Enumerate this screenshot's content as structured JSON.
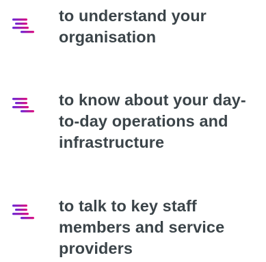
{
  "items": [
    {
      "text": "to understand your organisation",
      "icon": "lines-icon"
    },
    {
      "text": "to know about your day-to-day operations and infrastructure",
      "icon": "lines-icon"
    },
    {
      "text": "to talk to key staff members and service providers",
      "icon": "lines-icon"
    }
  ],
  "colors": {
    "text": "#3b4449",
    "icon_start": "#6a2bd9",
    "icon_end": "#e0117f"
  }
}
